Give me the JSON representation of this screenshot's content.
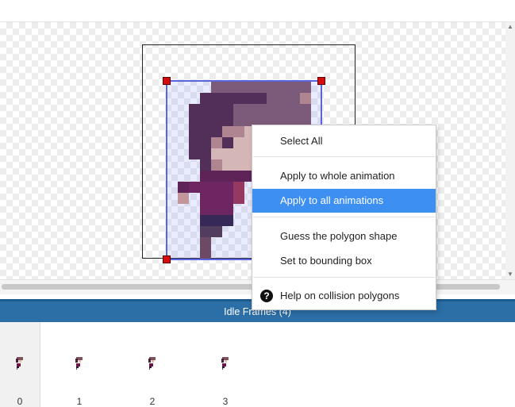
{
  "frames_panel": {
    "title": "Idle Frames (4)",
    "frames": [
      {
        "number": "0",
        "selected": true
      },
      {
        "number": "1",
        "selected": false
      },
      {
        "number": "2",
        "selected": false
      },
      {
        "number": "3",
        "selected": false
      }
    ]
  },
  "context_menu": {
    "items": [
      {
        "label": "Select All",
        "highlighted": false
      },
      {
        "label": "Apply to whole animation",
        "highlighted": false
      },
      {
        "label": "Apply to all animations",
        "highlighted": true
      },
      {
        "label": "Guess the polygon shape",
        "highlighted": false
      },
      {
        "label": "Set to bounding box",
        "highlighted": false
      },
      {
        "label": "Help on collision polygons",
        "highlighted": false,
        "icon": "question-circle-icon"
      }
    ]
  },
  "colors": {
    "panel_header": "#2c6fa7",
    "menu_highlight": "#3e8ff2",
    "polygon_outline": "#5a63e0",
    "vertex_handle": "#d60c0c"
  }
}
